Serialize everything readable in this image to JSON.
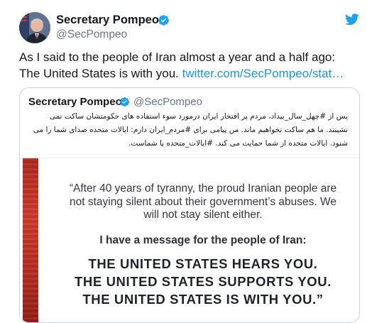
{
  "tweet": {
    "author_name": "Secretary Pompeo",
    "author_handle": "@SecPompeo",
    "text": "As I said to the people of Iran almost a year and a half ago: The United States is with you.",
    "link": "twitter.com/SecPompeo/stat…"
  },
  "quoted": {
    "author_name": "Secretary Pompeo",
    "author_handle": "@SecPompeo",
    "text": "پس از #چهل_سال_بیداد، مردم پر افتخار ایران درمورد سوء استفاده های حکومتشان ساکت نمی نشینند. ما هم ساکت نخواهیم ماند. من پیامی برای #مردم_ایران دارم: ایالات متحده صدای شما را می شنود. ایالات متحده از شما حمایت می کند. #ایالات_متحده با شماست.",
    "card": {
      "quote": "“After 40 years of tyranny, the proud Iranian people are not staying silent about their government’s abuses. We will not stay silent either.",
      "message": "I have a message for the people of Iran:",
      "line1": "THE UNITED STATES HEARS YOU.",
      "line2": "THE UNITED STATES SUPPORTS YOU.",
      "line3": "THE UNITED STATES IS WITH YOU.”"
    }
  },
  "icons": {
    "verified": "verified-badge-icon",
    "platform": "twitter-bird-icon"
  },
  "colors": {
    "link": "#1b95e0",
    "verified": "#1da1f2",
    "card_bar": "#c0322a"
  }
}
